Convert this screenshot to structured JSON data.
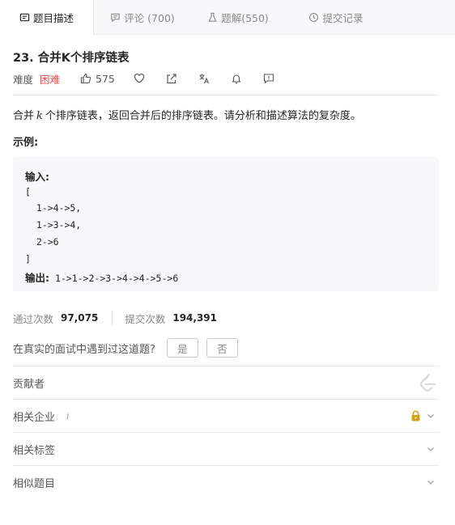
{
  "tabs": [
    {
      "label": "题目描述",
      "icon": "description-icon"
    },
    {
      "label": "评论 (700)",
      "icon": "comment-icon"
    },
    {
      "label": "题解(550)",
      "icon": "flask-icon"
    },
    {
      "label": "提交记录",
      "icon": "clock-icon"
    }
  ],
  "problem": {
    "title": "23. 合并K个排序链表",
    "difficulty_label": "难度",
    "difficulty": "困难",
    "likes": "575",
    "description_pre": "合并",
    "description_var": "k",
    "description_post": "个排序链表，返回合并后的排序链表。请分析和描述算法的复杂度。",
    "example_label": "示例:",
    "example": {
      "input_label": "输入:",
      "input_lines": [
        "[",
        "  1->4->5,",
        "  1->3->4,",
        "  2->6",
        "]"
      ],
      "output_label": "输出:",
      "output_value": "1->1->2->3->4->4->5->6"
    }
  },
  "stats": {
    "accepted_label": "通过次数",
    "accepted": "97,075",
    "submissions_label": "提交次数",
    "submissions": "194,391"
  },
  "interview": {
    "question": "在真实的面试中遇到过这道题?",
    "yes": "是",
    "no": "否"
  },
  "sections": {
    "contributors": "贡献者",
    "companies": "相关企业",
    "companies_info": "i",
    "tags": "相关标签",
    "similar": "相似题目"
  },
  "colors": {
    "difficulty_hard": "#ec4c47",
    "lock": "#d4a017"
  }
}
